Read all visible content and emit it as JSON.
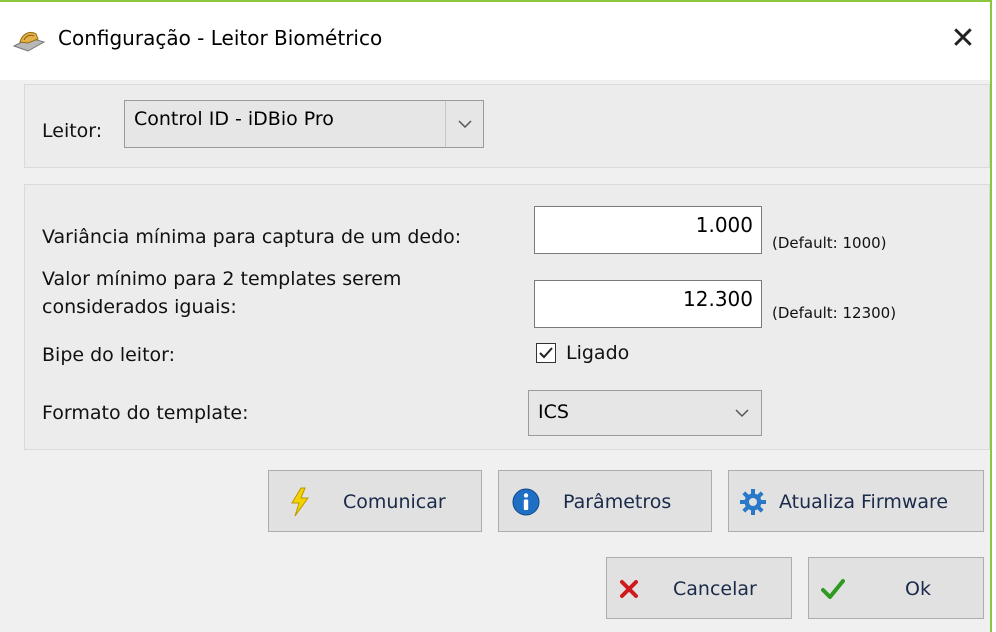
{
  "window": {
    "title": "Configuração - Leitor Biométrico",
    "close_glyph": "✕"
  },
  "reader": {
    "label": "Leitor:",
    "selected": "Control ID - iDBio Pro"
  },
  "settings": {
    "variance_label": "Variância mínima para captura de um dedo:",
    "variance_value": "1.000",
    "variance_default": "(Default: 1000)",
    "templates_label_line1": "Valor mínimo para 2 templates serem",
    "templates_label_line2": "considerados iguais:",
    "templates_value": "12.300",
    "templates_default": "(Default: 12300)",
    "beep_label": "Bipe do leitor:",
    "beep_checkbox_label": "Ligado",
    "beep_checked": true,
    "format_label": "Formato do template:",
    "format_selected": "ICS"
  },
  "buttons": {
    "comunicar": "Comunicar",
    "parametros": "Parâmetros",
    "firmware": "Atualiza Firmware",
    "cancelar": "Cancelar",
    "ok": "Ok"
  },
  "icons": {
    "app": "fingerprint-reader-icon",
    "comunicar": "lightning-icon",
    "parametros": "info-icon",
    "firmware": "gear-icon",
    "cancelar": "cross-icon",
    "ok": "checkmark-icon"
  },
  "colors": {
    "accent_border": "#8cc63f",
    "info_blue": "#1f6fc5",
    "cancel_red": "#d0191c",
    "ok_green": "#2e9a1f",
    "lightning_yellow": "#f5d300"
  }
}
